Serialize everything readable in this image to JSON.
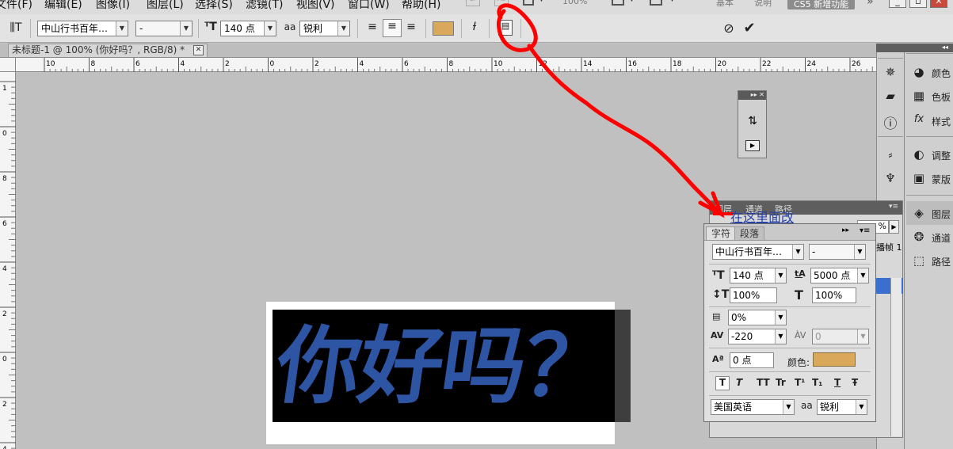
{
  "menu": {
    "items": [
      "文件(F)",
      "编辑(E)",
      "图像(I)",
      "图层(L)",
      "选择(S)",
      "滤镜(T)",
      "视图(V)",
      "窗口(W)",
      "帮助(H)"
    ],
    "zoom_value": "100%",
    "workspaces": [
      "基本",
      "说明"
    ],
    "cs5_button": "CS5 新增功能",
    "overflow_glyph": "»"
  },
  "options_bar": {
    "font_family": "中山行书百年…",
    "font_style": "-",
    "font_size": "140 点",
    "aa_icon_text": "aa",
    "anti_alias": "锐利",
    "text_color": "#d9a85b"
  },
  "document": {
    "tab_title": "未标题-1 @ 100% (你好吗？, RGB/8) *",
    "canvas_text": "你好吗？",
    "text_color": "#2e55a3"
  },
  "rulers": {
    "h_ticks": [
      "10",
      "8",
      "6",
      "4",
      "2",
      "0",
      "2",
      "4",
      "6",
      "8",
      "10",
      "12",
      "14",
      "16",
      "18",
      "20",
      "22",
      "24",
      "26"
    ],
    "v_ticks": [
      "1",
      "0",
      "8",
      "6",
      "4",
      "2",
      "0",
      "2",
      "4"
    ]
  },
  "annotation": {
    "note": "在这里面改",
    "color": "#ff0000"
  },
  "dock": {
    "labels": [
      "颜色",
      "色板",
      "样式",
      "调整",
      "蒙版",
      "图层",
      "通道",
      "路径"
    ],
    "icons": [
      "color-icon",
      "swatches-icon",
      "styles-icon",
      "adjustments-icon",
      "masks-icon",
      "layers-icon",
      "channels-icon",
      "paths-icon"
    ],
    "left_icons": [
      "navigator-icon",
      "histogram-icon",
      "info-icon",
      "brush-icon",
      "clone-icon"
    ]
  },
  "layers_panel": {
    "tabs": [
      "图层",
      "通道",
      "路径"
    ],
    "opacity_value": "%",
    "frame_label": "播帧 1"
  },
  "character_panel": {
    "tabs": [
      "字符",
      "段落"
    ],
    "font_family": "中山行书百年…",
    "font_style": "-",
    "font_size": "140 点",
    "leading": "5000 点",
    "vertical_scale": "100%",
    "horizontal_scale": "100%",
    "tsume": "0%",
    "tracking": "-220",
    "kerning": "0",
    "baseline_shift": "0 点",
    "color_label": "颜色:",
    "color": "#d9a85b",
    "language": "美国英语",
    "aa_label": "aa",
    "anti_alias": "锐利",
    "style_buttons": [
      "T",
      "T",
      "TT",
      "Tr",
      "T¹",
      "T₁",
      "T",
      "Ŧ"
    ]
  }
}
